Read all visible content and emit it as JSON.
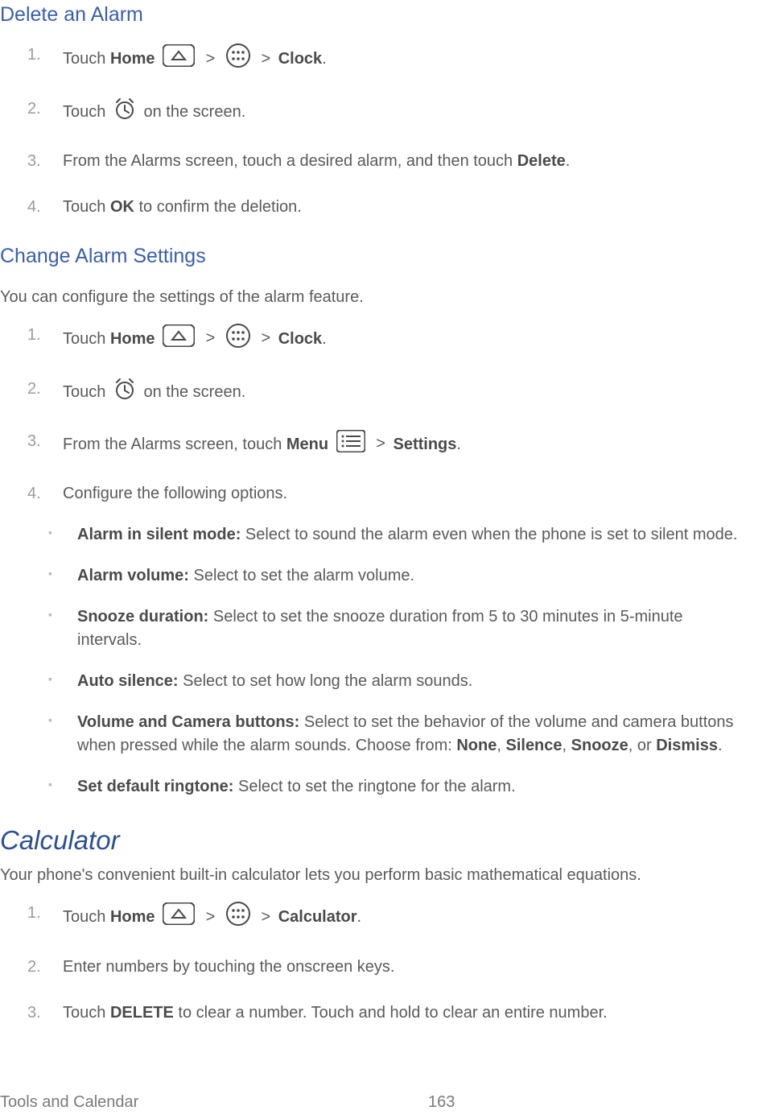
{
  "delete_alarm": {
    "heading": "Delete an Alarm",
    "steps": {
      "s1_prefix": "Touch ",
      "s1_home": "Home",
      "s1_clock": "Clock",
      "s1_dot": ".",
      "s2_prefix": "Touch ",
      "s2_suffix": " on the screen.",
      "s3_prefix": "From the Alarms screen, touch a desired alarm, and then touch ",
      "s3_delete": "Delete",
      "s3_dot": ".",
      "s4_prefix": "Touch ",
      "s4_ok": "OK",
      "s4_suffix": " to confirm the deletion."
    }
  },
  "change_settings": {
    "heading": "Change Alarm Settings",
    "intro": "You can configure the settings of the alarm feature.",
    "steps": {
      "s1_prefix": "Touch ",
      "s1_home": "Home",
      "s1_clock": "Clock",
      "s1_dot": ".",
      "s2_prefix": "Touch ",
      "s2_suffix": " on the screen.",
      "s3_prefix": "From the Alarms screen, touch ",
      "s3_menu": "Menu",
      "s3_settings": "Settings",
      "s3_dot": ".",
      "s4": "Configure the following options."
    },
    "options": {
      "o1_title": "Alarm in silent mode:",
      "o1_body": " Select to sound the alarm even when the phone is set to silent mode.",
      "o2_title": "Alarm volume:",
      "o2_body": " Select to set the alarm volume.",
      "o3_title": "Snooze duration:",
      "o3_body": " Select to set the snooze duration from 5 to 30 minutes in 5-minute intervals.",
      "o4_title": "Auto silence:",
      "o4_body": " Select to set how long the alarm sounds.",
      "o5_title": "Volume and Camera buttons:",
      "o5_body_a": " Select to set the behavior of the volume and camera buttons when pressed while the alarm sounds. Choose from: ",
      "o5_none": "None",
      "o5_comma1": ", ",
      "o5_silence": "Silence",
      "o5_comma2": ", ",
      "o5_snooze": "Snooze",
      "o5_or": ", or ",
      "o5_dismiss": "Dismiss",
      "o5_dot": ".",
      "o6_title": "Set default ringtone:",
      "o6_body": " Select to set the ringtone for the alarm."
    }
  },
  "calculator": {
    "heading": "Calculator",
    "intro": "Your phone's convenient built-in calculator lets you perform basic mathematical equations.",
    "steps": {
      "s1_prefix": "Touch ",
      "s1_home": "Home",
      "s1_calc": "Calculator",
      "s1_dot": ".",
      "s2": "Enter numbers by touching the onscreen keys.",
      "s3_prefix": "Touch ",
      "s3_delete": "DELETE",
      "s3_suffix": " to clear a number. Touch and hold to clear an entire number."
    }
  },
  "gt": ">",
  "footer": {
    "left": "Tools and Calendar",
    "page": "163"
  }
}
